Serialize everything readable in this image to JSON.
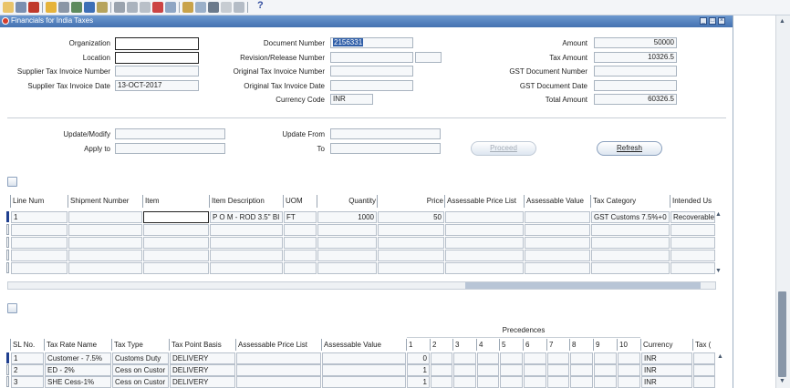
{
  "toolbar": {
    "icons": [
      "new-icon",
      "open-icon",
      "save-icon",
      "next-step-icon",
      "print-icon",
      "find-icon",
      "zoom-icon",
      "cut-icon",
      "copy-icon",
      "paste-icon",
      "clear-icon",
      "delete-icon",
      "edit-icon",
      "folder-icon",
      "attachments-icon",
      "translations-icon",
      "refresh-icon",
      "help-icon"
    ],
    "help_label": "?"
  },
  "window": {
    "title": "Financials for India Taxes",
    "title_bar_color": "#4a78b8"
  },
  "header": {
    "organization_label": "Organization",
    "organization_value": "",
    "location_label": "Location",
    "location_value": "",
    "supplier_tax_invoice_number_label": "Supplier Tax Invoice Number",
    "supplier_tax_invoice_number_value": "",
    "supplier_tax_invoice_date_label": "Supplier Tax Invoice Date",
    "supplier_tax_invoice_date_value": "13-OCT-2017",
    "document_number_label": "Document Number",
    "document_number_value": "2156331",
    "revision_release_number_label": "Revision/Release Number",
    "revision_release_number_value": "",
    "original_tax_invoice_number_label": "Original Tax Invoice Number",
    "original_tax_invoice_number_value": "",
    "original_tax_invoice_date_label": "Original Tax Invoice Date",
    "original_tax_invoice_date_value": "",
    "currency_code_label": "Currency Code",
    "currency_code_value": "INR",
    "amount_label": "Amount",
    "amount_value": "50000",
    "tax_amount_label": "Tax Amount",
    "tax_amount_value": "10326.5",
    "gst_document_number_label": "GST Document Number",
    "gst_document_number_value": "",
    "gst_document_date_label": "GST Document Date",
    "gst_document_date_value": "",
    "total_amount_label": "Total Amount",
    "total_amount_value": "60326.5"
  },
  "update": {
    "update_modify_label": "Update/Modify",
    "update_modify_value": "",
    "apply_to_label": "Apply to",
    "apply_to_value": "",
    "update_from_label": "Update From",
    "update_from_value": "",
    "to_label": "To",
    "to_value": "",
    "proceed_label": "Proceed",
    "refresh_label": "Refresh"
  },
  "lines_table": {
    "columns": [
      "Line Num",
      "Shipment Number",
      "Item",
      "Item Description",
      "UOM",
      "Quantity",
      "Price",
      "Assessable Price List",
      "Assessable Value",
      "Tax Category",
      "Intended Us"
    ],
    "rows": [
      [
        "1",
        "",
        "",
        "P O M - ROD 3.5\" BI",
        "FT",
        "1000",
        "50",
        "",
        "",
        "GST Customs 7.5%+0",
        "Recoverable"
      ],
      [
        "",
        "",
        "",
        "",
        "",
        "",
        "",
        "",
        "",
        "",
        ""
      ],
      [
        "",
        "",
        "",
        "",
        "",
        "",
        "",
        "",
        "",
        "",
        ""
      ],
      [
        "",
        "",
        "",
        "",
        "",
        "",
        "",
        "",
        "",
        "",
        ""
      ],
      [
        "",
        "",
        "",
        "",
        "",
        "",
        "",
        "",
        "",
        "",
        ""
      ]
    ]
  },
  "taxes_table": {
    "precedences_label": "Precedences",
    "columns": [
      "SL No.",
      "Tax Rate Name",
      "Tax Type",
      "Tax Point Basis",
      "Assessable Price List",
      "Assessable Value",
      "1",
      "2",
      "3",
      "4",
      "5",
      "6",
      "7",
      "8",
      "9",
      "10",
      "Currency",
      "Tax ("
    ],
    "rows": [
      [
        "1",
        "Customer - 7.5%",
        "Customs Duty",
        "DELIVERY",
        "",
        "",
        "0",
        "",
        "",
        "",
        "",
        "",
        "",
        "",
        "",
        "",
        "INR",
        ""
      ],
      [
        "2",
        "ED - 2%",
        "Cess on Custor",
        "DELIVERY",
        "",
        "",
        "1",
        "",
        "",
        "",
        "",
        "",
        "",
        "",
        "",
        "",
        "INR",
        ""
      ],
      [
        "3",
        "SHE Cess-1%",
        "Cess on Custor",
        "DELIVERY",
        "",
        "",
        "1",
        "",
        "",
        "",
        "",
        "",
        "",
        "",
        "",
        "",
        "INR",
        ""
      ]
    ]
  }
}
